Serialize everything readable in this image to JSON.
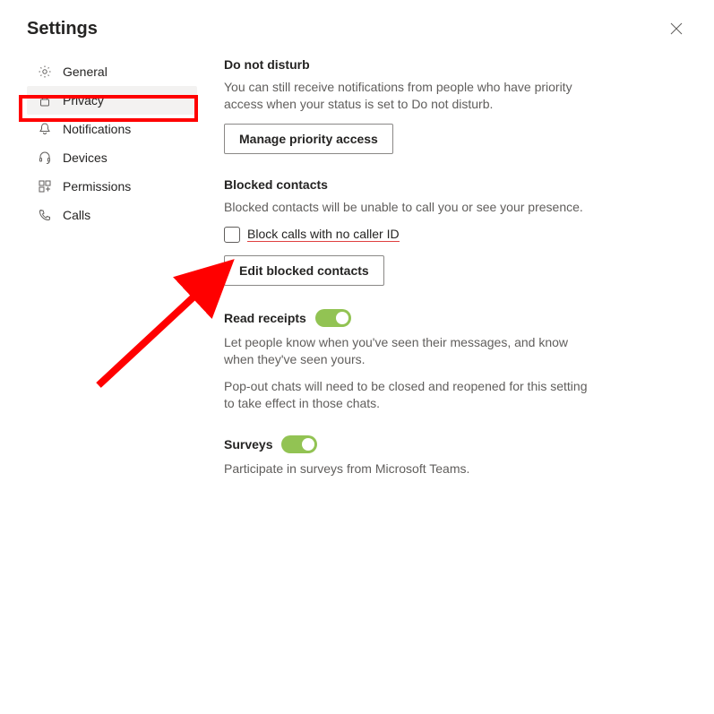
{
  "header": {
    "title": "Settings"
  },
  "sidebar": {
    "items": [
      {
        "label": "General"
      },
      {
        "label": "Privacy"
      },
      {
        "label": "Notifications"
      },
      {
        "label": "Devices"
      },
      {
        "label": "Permissions"
      },
      {
        "label": "Calls"
      }
    ]
  },
  "content": {
    "dnd": {
      "title": "Do not disturb",
      "desc": "You can still receive notifications from people who have priority access when your status is set to Do not disturb.",
      "button": "Manage priority access"
    },
    "blocked": {
      "title": "Blocked contacts",
      "desc": "Blocked contacts will be unable to call you or see your presence.",
      "checkbox_label": "Block calls with no caller ID",
      "button": "Edit blocked contacts"
    },
    "readreceipts": {
      "title": "Read receipts",
      "desc1": "Let people know when you've seen their messages, and know when they've seen yours.",
      "desc2": "Pop-out chats will need to be closed and reopened for this setting to take effect in those chats."
    },
    "surveys": {
      "title": "Surveys",
      "desc": "Participate in surveys from Microsoft Teams."
    }
  }
}
